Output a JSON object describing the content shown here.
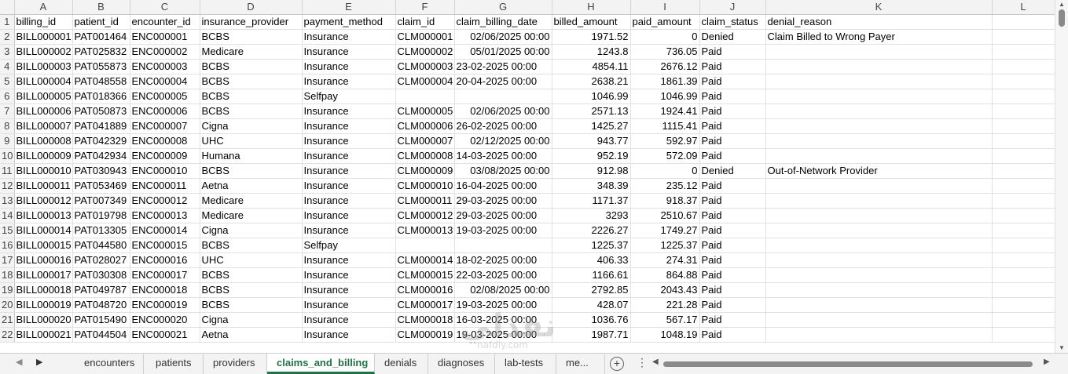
{
  "columns": [
    "A",
    "B",
    "C",
    "D",
    "E",
    "F",
    "G",
    "H",
    "I",
    "J",
    "K",
    "L"
  ],
  "headers": [
    "billing_id",
    "patient_id",
    "encounter_id",
    "insurance_provider",
    "payment_method",
    "claim_id",
    "claim_billing_date",
    "billed_amount",
    "paid_amount",
    "claim_status",
    "denial_reason",
    ""
  ],
  "rows": [
    [
      "BILL000001",
      "PAT001464",
      "ENC000001",
      "BCBS",
      "Insurance",
      "CLM000001",
      "02/06/2025 00:00",
      "1971.52",
      "0",
      "Denied",
      "Claim Billed to Wrong Payer",
      ""
    ],
    [
      "BILL000002",
      "PAT025832",
      "ENC000002",
      "Medicare",
      "Insurance",
      "CLM000002",
      "05/01/2025 00:00",
      "1243.8",
      "736.05",
      "Paid",
      "",
      ""
    ],
    [
      "BILL000003",
      "PAT055873",
      "ENC000003",
      "BCBS",
      "Insurance",
      "CLM000003",
      "23-02-2025 00:00",
      "4854.11",
      "2676.12",
      "Paid",
      "",
      ""
    ],
    [
      "BILL000004",
      "PAT048558",
      "ENC000004",
      "BCBS",
      "Insurance",
      "CLM000004",
      "20-04-2025 00:00",
      "2638.21",
      "1861.39",
      "Paid",
      "",
      ""
    ],
    [
      "BILL000005",
      "PAT018366",
      "ENC000005",
      "BCBS",
      "Selfpay",
      "",
      "",
      "1046.99",
      "1046.99",
      "Paid",
      "",
      ""
    ],
    [
      "BILL000006",
      "PAT050873",
      "ENC000006",
      "BCBS",
      "Insurance",
      "CLM000005",
      "02/06/2025 00:00",
      "2571.13",
      "1924.41",
      "Paid",
      "",
      ""
    ],
    [
      "BILL000007",
      "PAT041889",
      "ENC000007",
      "Cigna",
      "Insurance",
      "CLM000006",
      "26-02-2025 00:00",
      "1425.27",
      "1115.41",
      "Paid",
      "",
      ""
    ],
    [
      "BILL000008",
      "PAT042329",
      "ENC000008",
      "UHC",
      "Insurance",
      "CLM000007",
      "02/12/2025 00:00",
      "943.77",
      "592.97",
      "Paid",
      "",
      ""
    ],
    [
      "BILL000009",
      "PAT042934",
      "ENC000009",
      "Humana",
      "Insurance",
      "CLM000008",
      "14-03-2025 00:00",
      "952.19",
      "572.09",
      "Paid",
      "",
      ""
    ],
    [
      "BILL000010",
      "PAT030943",
      "ENC000010",
      "BCBS",
      "Insurance",
      "CLM000009",
      "03/08/2025 00:00",
      "912.98",
      "0",
      "Denied",
      "Out-of-Network Provider",
      ""
    ],
    [
      "BILL000011",
      "PAT053469",
      "ENC000011",
      "Aetna",
      "Insurance",
      "CLM000010",
      "16-04-2025 00:00",
      "348.39",
      "235.12",
      "Paid",
      "",
      ""
    ],
    [
      "BILL000012",
      "PAT007349",
      "ENC000012",
      "Medicare",
      "Insurance",
      "CLM000011",
      "29-03-2025 00:00",
      "1171.37",
      "918.37",
      "Paid",
      "",
      ""
    ],
    [
      "BILL000013",
      "PAT019798",
      "ENC000013",
      "Medicare",
      "Insurance",
      "CLM000012",
      "29-03-2025 00:00",
      "3293",
      "2510.67",
      "Paid",
      "",
      ""
    ],
    [
      "BILL000014",
      "PAT013305",
      "ENC000014",
      "Cigna",
      "Insurance",
      "CLM000013",
      "19-03-2025 00:00",
      "2226.27",
      "1749.27",
      "Paid",
      "",
      ""
    ],
    [
      "BILL000015",
      "PAT044580",
      "ENC000015",
      "BCBS",
      "Selfpay",
      "",
      "",
      "1225.37",
      "1225.37",
      "Paid",
      "",
      ""
    ],
    [
      "BILL000016",
      "PAT028027",
      "ENC000016",
      "UHC",
      "Insurance",
      "CLM000014",
      "18-02-2025 00:00",
      "406.33",
      "274.31",
      "Paid",
      "",
      ""
    ],
    [
      "BILL000017",
      "PAT030308",
      "ENC000017",
      "BCBS",
      "Insurance",
      "CLM000015",
      "22-03-2025 00:00",
      "1166.61",
      "864.88",
      "Paid",
      "",
      ""
    ],
    [
      "BILL000018",
      "PAT049787",
      "ENC000018",
      "BCBS",
      "Insurance",
      "CLM000016",
      "02/08/2025 00:00",
      "2792.85",
      "2043.43",
      "Paid",
      "",
      ""
    ],
    [
      "BILL000019",
      "PAT048720",
      "ENC000019",
      "BCBS",
      "Insurance",
      "CLM000017",
      "19-03-2025 00:00",
      "428.07",
      "221.28",
      "Paid",
      "",
      ""
    ],
    [
      "BILL000020",
      "PAT015490",
      "ENC000020",
      "Cigna",
      "Insurance",
      "CLM000018",
      "16-03-2025 00:00",
      "1036.76",
      "567.17",
      "Paid",
      "",
      ""
    ],
    [
      "BILL000021",
      "PAT044504",
      "ENC000021",
      "Aetna",
      "Insurance",
      "CLM000019",
      "19-03-2025 00:00",
      "1987.71",
      "1048.19",
      "Paid",
      "",
      ""
    ]
  ],
  "tabs": [
    "encounters",
    "patients",
    "providers",
    "claims_and_billing",
    "denials",
    "diagnoses",
    "lab-tests",
    "me..."
  ],
  "active_tab": "claims_and_billing",
  "watermark": {
    "main": "نفذلي",
    "sub": "nafdly.com"
  },
  "colors": {
    "active_tab": "#217346",
    "header_bg": "#f3f3f3",
    "grid": "#e1e1e1"
  },
  "icons": {
    "add_sheet": "plus-circle-icon",
    "more": "vertical-dots-icon",
    "prev": "chevron-left-icon",
    "next": "chevron-right-icon"
  }
}
